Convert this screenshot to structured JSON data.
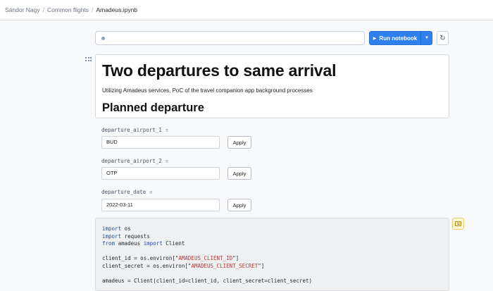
{
  "breadcrumb": {
    "items": [
      "Sándor Nagy",
      "Common flights",
      "Amadeus.ipynb"
    ],
    "separator": "/"
  },
  "toolbar": {
    "run_label": "Run notebook"
  },
  "markdown": {
    "title": "Two departures to same arrival",
    "subtitle": "Utilizing Amadeus services, PoC of the travel companion app background processes",
    "heading": "Planned departure"
  },
  "parameters": [
    {
      "name": "departure_airport_1",
      "value": "BUD",
      "apply_label": "Apply"
    },
    {
      "name": "departure_airport_2",
      "value": "OTP",
      "apply_label": "Apply"
    },
    {
      "name": "departure_date",
      "value": "2022-03-11",
      "apply_label": "Apply"
    }
  ],
  "code": {
    "lines": [
      "import os",
      "import requests",
      "from amadeus import Client",
      "",
      "client_id = os.environ[\"AMADEUS_CLIENT_ID\"]",
      "client_secret = os.environ[\"AMADEUS_CLIENT_SECRET\"]",
      "",
      "amadeus = Client(client_id=client_id, client_secret=client_secret)"
    ]
  },
  "colors": {
    "accent": "#2f80ed",
    "keyword": "#1f4fa8",
    "string": "#b23b3b",
    "comment_badge": "#fff7d6"
  },
  "icons": {
    "run": "play-icon",
    "dropdown": "chevron-down-icon",
    "refresh": "refresh-icon",
    "drag": "drag-handle-icon",
    "param": "text-param-icon",
    "comment": "comment-icon"
  }
}
